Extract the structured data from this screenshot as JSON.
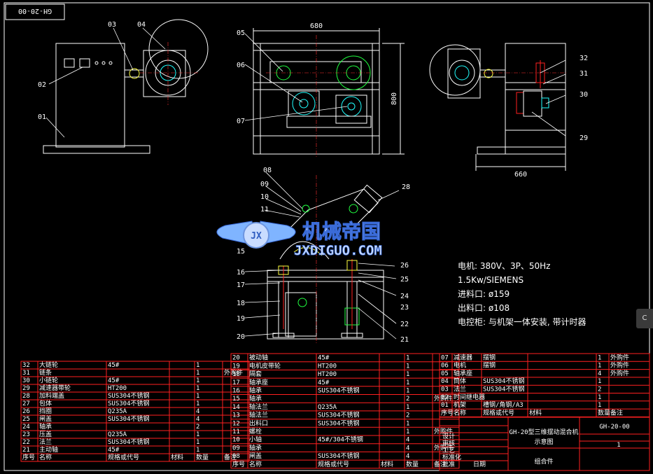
{
  "drawing_number_tag": "GH-20-00",
  "part_callouts": [
    "01",
    "02",
    "03",
    "04",
    "05",
    "06",
    "07",
    "08",
    "09",
    "10",
    "11",
    "13",
    "15",
    "16",
    "17",
    "18",
    "19",
    "20",
    "21",
    "22",
    "23",
    "24",
    "25",
    "26",
    "28",
    "29",
    "30",
    "31",
    "32"
  ],
  "dimensions": {
    "front_width": "680",
    "front_height": "800",
    "side_width": "660"
  },
  "watermark": {
    "cn": "机械帝国",
    "en": "JXDIGUO.COM",
    "badge": "JX"
  },
  "specs": [
    "电机: 380V、3P、50Hz",
    "1.5Kw/SIEMENS",
    "进料口: ø159",
    "出料口: ø108",
    "电控柜: 与机架一体安装, 带计时器"
  ],
  "bom_left": [
    {
      "no": "32",
      "name": "大链轮",
      "spec": "45#",
      "qty": "1",
      "note": ""
    },
    {
      "no": "31",
      "name": "链条",
      "spec": "",
      "qty": "1",
      "note": "外购件"
    },
    {
      "no": "30",
      "name": "小链轮",
      "spec": "45#",
      "qty": "1",
      "note": ""
    },
    {
      "no": "29",
      "name": "减速器带轮",
      "spec": "HT200",
      "qty": "1",
      "note": ""
    },
    {
      "no": "28",
      "name": "加料端盖",
      "spec": "SUS304不锈钢",
      "qty": "1",
      "note": ""
    },
    {
      "no": "27",
      "name": "包体",
      "spec": "SUS304不锈钢",
      "qty": "1",
      "note": ""
    },
    {
      "no": "26",
      "name": "挡圈",
      "spec": "Q235A",
      "qty": "4",
      "note": ""
    },
    {
      "no": "25",
      "name": "闸盖",
      "spec": "SUS304不锈钢",
      "qty": "4",
      "note": ""
    },
    {
      "no": "24",
      "name": "轴承",
      "spec": "",
      "qty": "2",
      "note": ""
    },
    {
      "no": "23",
      "name": "压盖",
      "spec": "Q235A",
      "qty": "1",
      "note": ""
    },
    {
      "no": "22",
      "name": "法兰",
      "spec": "SUS304不锈钢",
      "qty": "1",
      "note": ""
    },
    {
      "no": "21",
      "name": "主动轴",
      "spec": "45#",
      "qty": "1",
      "note": ""
    }
  ],
  "bom_mid": [
    {
      "no": "20",
      "name": "被动轴",
      "spec": "45#",
      "qty": "1",
      "note": ""
    },
    {
      "no": "19",
      "name": "电机皮带轮",
      "spec": "HT200",
      "qty": "1",
      "note": ""
    },
    {
      "no": "18",
      "name": "隔套",
      "spec": "HT200",
      "qty": "1",
      "note": ""
    },
    {
      "no": "17",
      "name": "轴承座",
      "spec": "45#",
      "qty": "1",
      "note": ""
    },
    {
      "no": "16",
      "name": "轴承",
      "spec": "SUS304不锈钢",
      "qty": "1",
      "note": ""
    },
    {
      "no": "15",
      "name": "轴承",
      "spec": "",
      "qty": "2",
      "note": "外购件"
    },
    {
      "no": "14",
      "name": "轴法兰",
      "spec": "Q235A",
      "qty": "1",
      "note": ""
    },
    {
      "no": "13",
      "name": "轴法兰",
      "spec": "SUS304不锈钢",
      "qty": "2",
      "note": ""
    },
    {
      "no": "12",
      "name": "出料口",
      "spec": "SUS304不锈钢",
      "qty": "1",
      "note": ""
    },
    {
      "no": "11",
      "name": "螺栓",
      "spec": "",
      "qty": "1",
      "note": "外购件"
    },
    {
      "no": "10",
      "name": "小轴",
      "spec": "45#/304不锈钢",
      "qty": "4",
      "note": ""
    },
    {
      "no": "09",
      "name": "轴承",
      "spec": "",
      "qty": "4",
      "note": "外购件"
    },
    {
      "no": "08",
      "name": "闸盖",
      "spec": "SUS304不锈钢",
      "qty": "4",
      "note": ""
    }
  ],
  "bom_right": [
    {
      "no": "07",
      "name": "减速器",
      "spec": "摆钢",
      "qty": "1",
      "note": "外购件"
    },
    {
      "no": "06",
      "name": "电机",
      "spec": "摆钢",
      "qty": "1",
      "note": "外购件"
    },
    {
      "no": "05",
      "name": "轴承座",
      "spec": "",
      "qty": "4",
      "note": "外购件"
    },
    {
      "no": "04",
      "name": "筒体",
      "spec": "SUS304不锈钢",
      "qty": "1",
      "note": ""
    },
    {
      "no": "03",
      "name": "法兰",
      "spec": "SUS304不锈钢",
      "qty": "2",
      "note": ""
    },
    {
      "no": "02",
      "name": "时间继电器",
      "spec": "",
      "qty": "1",
      "note": ""
    },
    {
      "no": "01",
      "name": "机架",
      "spec": "槽钢/角钢/A3",
      "qty": "1",
      "note": ""
    }
  ],
  "bom_header": [
    "序号",
    "名称",
    "规格或代号",
    "材料",
    "数量",
    "备注"
  ],
  "bom_header_right": [
    "序号",
    "名称",
    "规格或代号",
    "材料",
    "数量",
    "备注"
  ],
  "title_block": {
    "product": "GH-20型三维摆动混合机",
    "drawing_type": "示意图",
    "drawing_no": "GH-20-00",
    "assembly": "组合件",
    "scale_qty": "1",
    "roles": [
      "设计",
      "审核",
      "工艺",
      "标准化",
      "批准",
      "日期"
    ]
  },
  "side_tab_label": "C"
}
